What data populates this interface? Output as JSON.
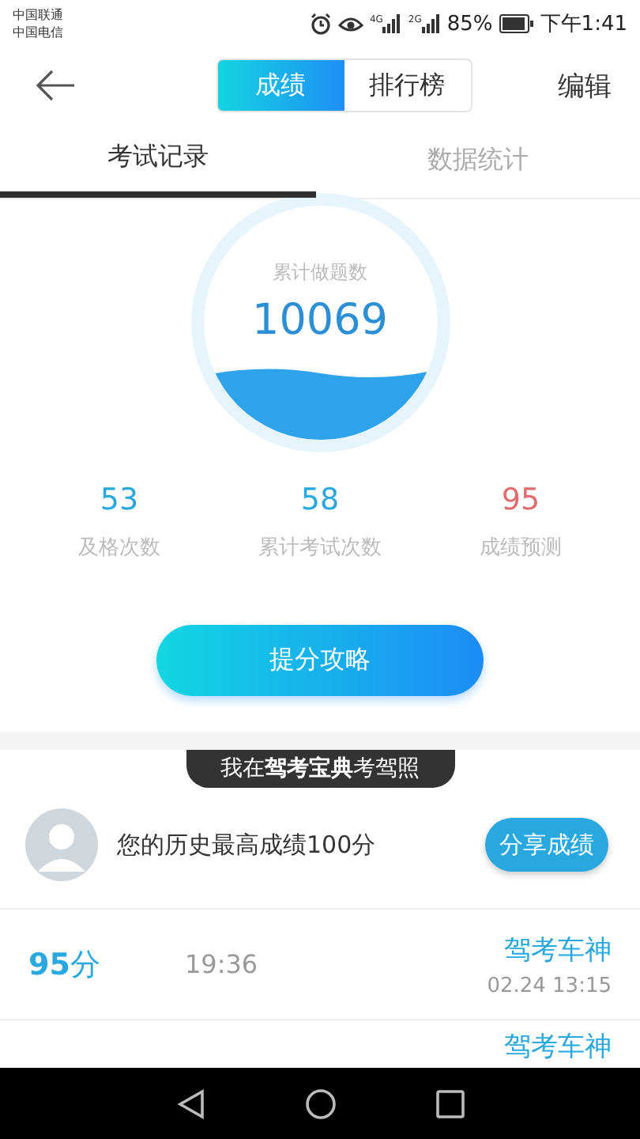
{
  "status_bar": {
    "carriers": [
      "中国联通",
      "中国电信"
    ],
    "signal_labels": [
      "4G",
      "2G"
    ],
    "battery": "85%",
    "time": "下午1:41"
  },
  "header": {
    "segments": [
      {
        "label": "成绩",
        "selected": true
      },
      {
        "label": "排行榜",
        "selected": false
      }
    ],
    "action": "编辑"
  },
  "tabs": [
    {
      "label": "考试记录",
      "selected": true
    },
    {
      "label": "数据统计",
      "selected": false
    }
  ],
  "total": {
    "label": "累计做题数",
    "value": "10069"
  },
  "stats": [
    {
      "value": "53",
      "label": "及格次数",
      "color": "#29a8e0"
    },
    {
      "value": "58",
      "label": "累计考试次数",
      "color": "#29a8e0"
    },
    {
      "value": "95",
      "label": "成绩预测",
      "color": "#e06c6c"
    }
  ],
  "tips_button": "提分攻略",
  "banner": "我在**驾考宝典**考驾照",
  "best": {
    "text": "您的历史最高成绩100分",
    "share_button": "分享成绩"
  },
  "records": [
    {
      "score": "**95**分",
      "duration": "19:36",
      "title": "驾考车神",
      "date": "02.24  13:15"
    },
    {
      "title": "驾考车神"
    }
  ]
}
